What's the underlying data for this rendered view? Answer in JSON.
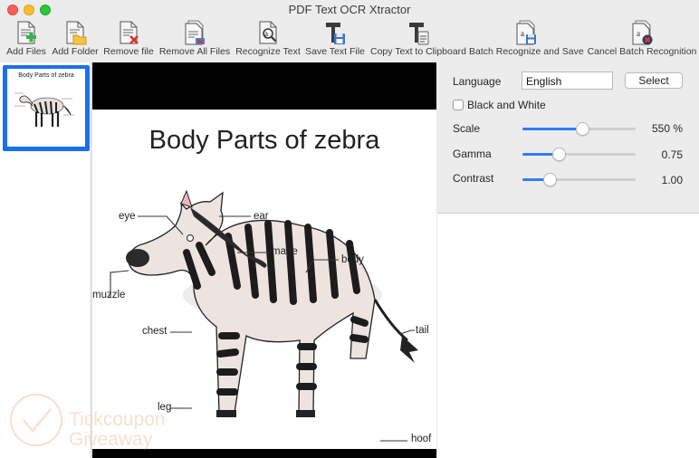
{
  "window": {
    "title": "PDF Text OCR Xtractor"
  },
  "toolbar": {
    "items": [
      {
        "label": "Add Files"
      },
      {
        "label": "Add Folder"
      },
      {
        "label": "Remove file"
      },
      {
        "label": "Remove All Files"
      },
      {
        "label": "Recognize Text"
      },
      {
        "label": "Save Text File"
      },
      {
        "label": "Copy Text to Clipboard"
      },
      {
        "label": "Batch Recognize and Save"
      },
      {
        "label": "Cancel Batch Recognition"
      }
    ]
  },
  "files": {
    "thumbnail_title": "Body Parts of zebra"
  },
  "preview": {
    "title": "Body Parts of zebra",
    "labels": [
      "eye",
      "ear",
      "mane",
      "body",
      "muzzle",
      "chest",
      "tail",
      "leg",
      "hoof"
    ]
  },
  "settings": {
    "language_label": "Language",
    "language_value": "English",
    "select_label": "Select",
    "bw_label": "Black and White",
    "scale_label": "Scale",
    "scale_value": "550 %",
    "scale_fraction": 0.53,
    "gamma_label": "Gamma",
    "gamma_value": "0.75",
    "gamma_fraction": 0.32,
    "contrast_label": "Contrast",
    "contrast_value": "1.00",
    "contrast_fraction": 0.24
  },
  "watermark": {
    "line1": "Tickcoupon",
    "line2": "Giveaway"
  },
  "colors": {
    "accent": "#2f7df6",
    "selection": "#1a6ff0"
  }
}
